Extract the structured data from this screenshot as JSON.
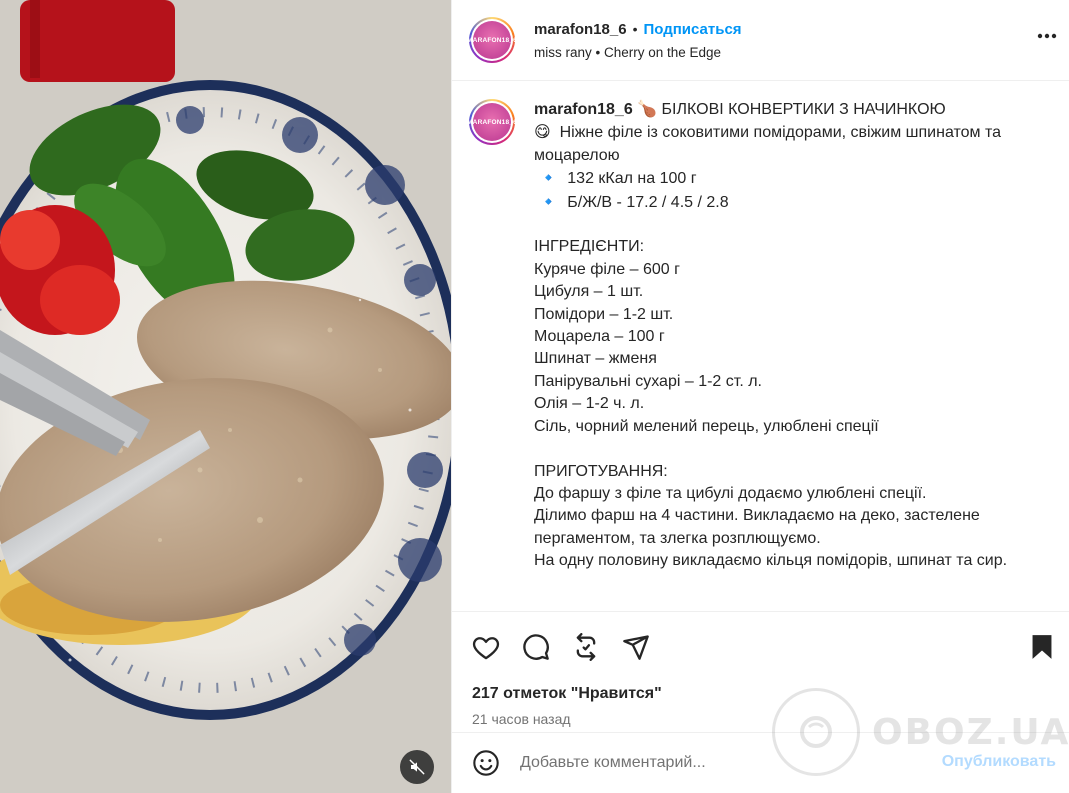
{
  "header": {
    "avatar_text": "MARAFON18_6",
    "username": "marafon18_6",
    "separator": "•",
    "follow_label": "Подписаться",
    "audio": "miss rany • Cherry on the Edge"
  },
  "caption": {
    "avatar_text": "MARAFON18_6",
    "username": "marafon18_6",
    "title_emoji": "🍗",
    "title": "БІЛКОВІ КОНВЕРТИКИ З НАЧИНКОЮ",
    "intro_emoji": "😋",
    "intro": "Ніжне філе із соковитими помідорами, свіжим шпинатом та моцарелою",
    "bullet": "🔹",
    "kcal": "132 кКал на 100 г",
    "bju": "Б/Ж/В - 17.2 / 4.5 / 2.8",
    "ingredients_heading": "ІНГРЕДІЄНТИ:",
    "ingredients": [
      "Куряче філе – 600 г",
      "Цибуля – 1 шт.",
      "Помідори – 1-2 шт.",
      "Моцарела – 100 г",
      "Шпинат – жменя",
      "Панірувальні сухарі – 1-2 ст. л.",
      "Олія – 1-2 ч. л.",
      "Сіль, чорний мелений перець, улюблені спеції"
    ],
    "steps_heading": "ПРИГОТУВАННЯ:",
    "steps": [
      "До фаршу з філе та цибулі додаємо улюблені спеції.",
      "Ділимо фарш на 4 частини. Викладаємо на деко, застелене пергаментом, та злегка розплющуємо.",
      "На одну половину викладаємо кільця помідорів, шпинат та сир."
    ]
  },
  "actions": {
    "like_icon": "heart-icon",
    "comment_icon": "comment-icon",
    "repost_icon": "repost-icon",
    "share_icon": "share-icon",
    "save_icon": "bookmark-icon",
    "likes_text": "217 отметок \"Нравится\"",
    "time_text": "21 часов назад"
  },
  "comment": {
    "emoji_icon": "smiley-icon",
    "placeholder": "Добавьте комментарий...",
    "publish_label": "Опубликовать"
  },
  "watermark": {
    "text": "OBOZ.UA"
  },
  "media": {
    "mute_icon": "speaker-muted-icon"
  },
  "colors": {
    "link": "#0095f6",
    "publish_disabled": "#b3dbff",
    "muted_text": "#737373",
    "text": "#262626"
  }
}
